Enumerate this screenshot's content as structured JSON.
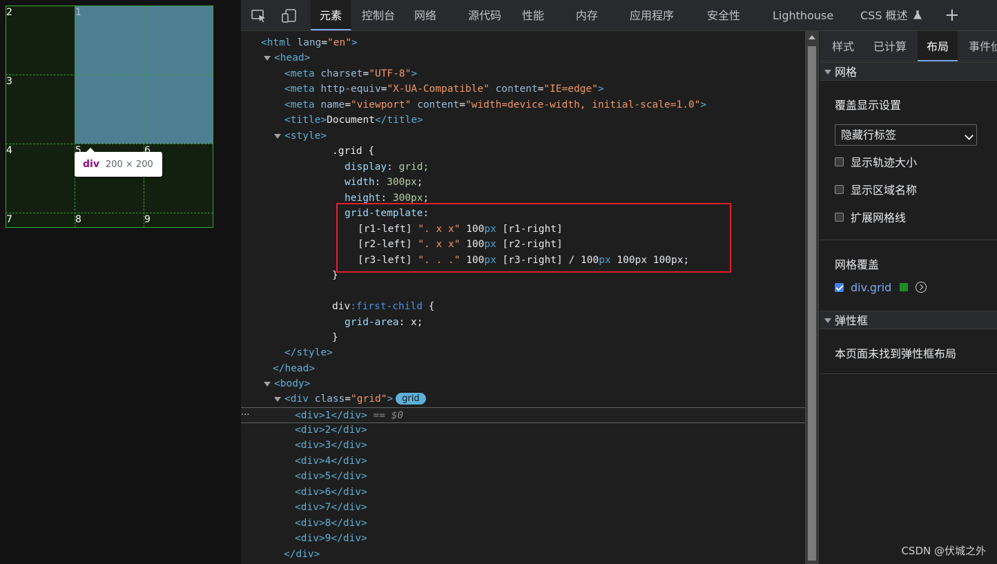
{
  "preview": {
    "cell_numbers": [
      "1",
      "2",
      "3",
      "4",
      "5",
      "6",
      "7",
      "8",
      "9"
    ],
    "tooltip": {
      "tag": "div",
      "size": "200 × 200"
    },
    "colors": {
      "highlight": "#4e7e92",
      "grid_line": "#3a9a3a"
    }
  },
  "toolbar": {
    "icons": [
      "inspect-element-icon",
      "device-toolbar-icon"
    ],
    "tabs": [
      "元素",
      "控制台",
      "网络",
      "源代码",
      "性能",
      "内存",
      "应用程序",
      "安全性",
      "Lighthouse",
      "CSS 概述"
    ],
    "active_tab": "元素",
    "add_tab": "+"
  },
  "code": {
    "l1_tag_open": "<html ",
    "l1_attr": "lang",
    "l1_eq": "=",
    "l1_val": "\"en\"",
    "l1_close": ">",
    "l2": "<head>",
    "l3_open": "<meta ",
    "l3_attr": "charset",
    "l3_val": "\"UTF-8\"",
    "l3_close": ">",
    "l4_open": "<meta ",
    "l4_attr1": "http-equiv",
    "l4_val1": "\"X-UA-Compatible\"",
    "l4_attr2": "content",
    "l4_val2": "\"IE=edge\"",
    "l4_close": ">",
    "l5_open": "<meta ",
    "l5_attr1": "name",
    "l5_val1": "\"viewport\"",
    "l5_attr2": "content",
    "l5_val2": "\"width=device-width, initial-scale=1.0\"",
    "l5_close": ">",
    "l6_open": "<title>",
    "l6_text": "Document",
    "l6_close": "</title>",
    "l7": "<style>",
    "l8": ".grid {",
    "l9_prop": "display",
    "l9_val": "grid;",
    "l10_prop": "width",
    "l10_num": "300px",
    "l10_semi": ";",
    "l11_prop": "height",
    "l11_num": "300px",
    "l11_semi": ";",
    "l12_prop": "grid-template",
    "l13_a": "[r1-left] ",
    "l13_s": "\". x x\"",
    "l13_n": " 100",
    "l13_u": "px",
    "l13_b": " [r1-right]",
    "l14_a": "[r2-left] ",
    "l14_s": "\". x x\"",
    "l14_n": " 100",
    "l14_u": "px",
    "l14_b": " [r2-right]",
    "l15_a": "[r3-left] ",
    "l15_s": "\". . .\"",
    "l15_n": " 100",
    "l15_u": "px",
    "l15_b": " [r3-right] / ",
    "l15_n2": "100",
    "l15_u2": "px",
    "l15_c": " 100px 100px;",
    "l16": "}",
    "l17_sel": "div",
    "l17_pseudo": ":first-child",
    "l17_brace": " {",
    "l18_prop": "grid-area",
    "l18_val": "x;",
    "l19": "}",
    "l20": "</style>",
    "l21": "</head>",
    "l22": "<body>",
    "l23_open": "<div ",
    "l23_attr": "class",
    "l23_val": "\"grid\"",
    "l23_close": ">",
    "l23_badge": "grid",
    "ellipsis": "···",
    "sel_suffix": "== $0",
    "children": [
      "<div>1</div>",
      "<div>2</div>",
      "<div>3</div>",
      "<div>4</div>",
      "<div>5</div>",
      "<div>6</div>",
      "<div>7</div>",
      "<div>8</div>",
      "<div>9</div>"
    ],
    "end_div": "</div>"
  },
  "sidebar": {
    "tabs": [
      "样式",
      "已计算",
      "布局",
      "事件侦"
    ],
    "active_tab": "布局",
    "grid_section": "网格",
    "overlay_settings_label": "覆盖显示设置",
    "select_value": "隐藏行标签",
    "checkboxes": [
      "显示轨迹大小",
      "显示区域名称",
      "扩展网格线"
    ],
    "overlay_label": "网格覆盖",
    "overlay_item": "div.grid",
    "overlay_color": "#1f8b24",
    "flex_section": "弹性框",
    "flex_empty": "本页面未找到弹性框布局"
  },
  "watermark": "CSDN @伏城之外"
}
